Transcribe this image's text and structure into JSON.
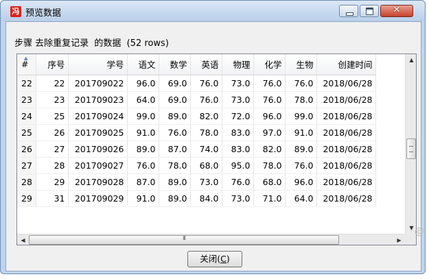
{
  "window": {
    "title": "预览数据",
    "app_icon_glyph": "冯",
    "close_glyph": "✕"
  },
  "caption": "步骤 去除重复记录  的数据  (52 rows)",
  "table": {
    "columns": [
      "#",
      "序号",
      "学号",
      "语文",
      "数学",
      "英语",
      "物理",
      "化学",
      "生物",
      "创建时间"
    ],
    "rows": [
      [
        "22",
        "22",
        "201709022",
        "96.0",
        "69.0",
        "76.0",
        "73.0",
        "76.0",
        "76.0",
        "2018/06/28"
      ],
      [
        "23",
        "23",
        "201709023",
        "64.0",
        "69.0",
        "76.0",
        "73.0",
        "76.0",
        "78.0",
        "2018/06/28"
      ],
      [
        "24",
        "25",
        "201709024",
        "99.0",
        "89.0",
        "82.0",
        "72.0",
        "96.0",
        "99.0",
        "2018/06/28"
      ],
      [
        "25",
        "26",
        "201709025",
        "91.0",
        "76.0",
        "78.0",
        "83.0",
        "97.0",
        "91.0",
        "2018/06/28"
      ],
      [
        "26",
        "27",
        "201709026",
        "89.0",
        "87.0",
        "74.0",
        "83.0",
        "82.0",
        "89.0",
        "2018/06/28"
      ],
      [
        "27",
        "28",
        "201709027",
        "76.0",
        "78.0",
        "68.0",
        "95.0",
        "78.0",
        "76.0",
        "2018/06/28"
      ],
      [
        "28",
        "29",
        "201709028",
        "87.0",
        "89.0",
        "73.0",
        "76.0",
        "68.0",
        "96.0",
        "2018/06/28"
      ],
      [
        "29",
        "31",
        "201709029",
        "91.0",
        "89.0",
        "84.0",
        "73.0",
        "71.0",
        "64.0",
        "2018/06/28"
      ]
    ]
  },
  "buttons": {
    "close_label": "关闭(",
    "close_accel": "C",
    "close_suffix": ")"
  },
  "watermark_glyph": "@"
}
